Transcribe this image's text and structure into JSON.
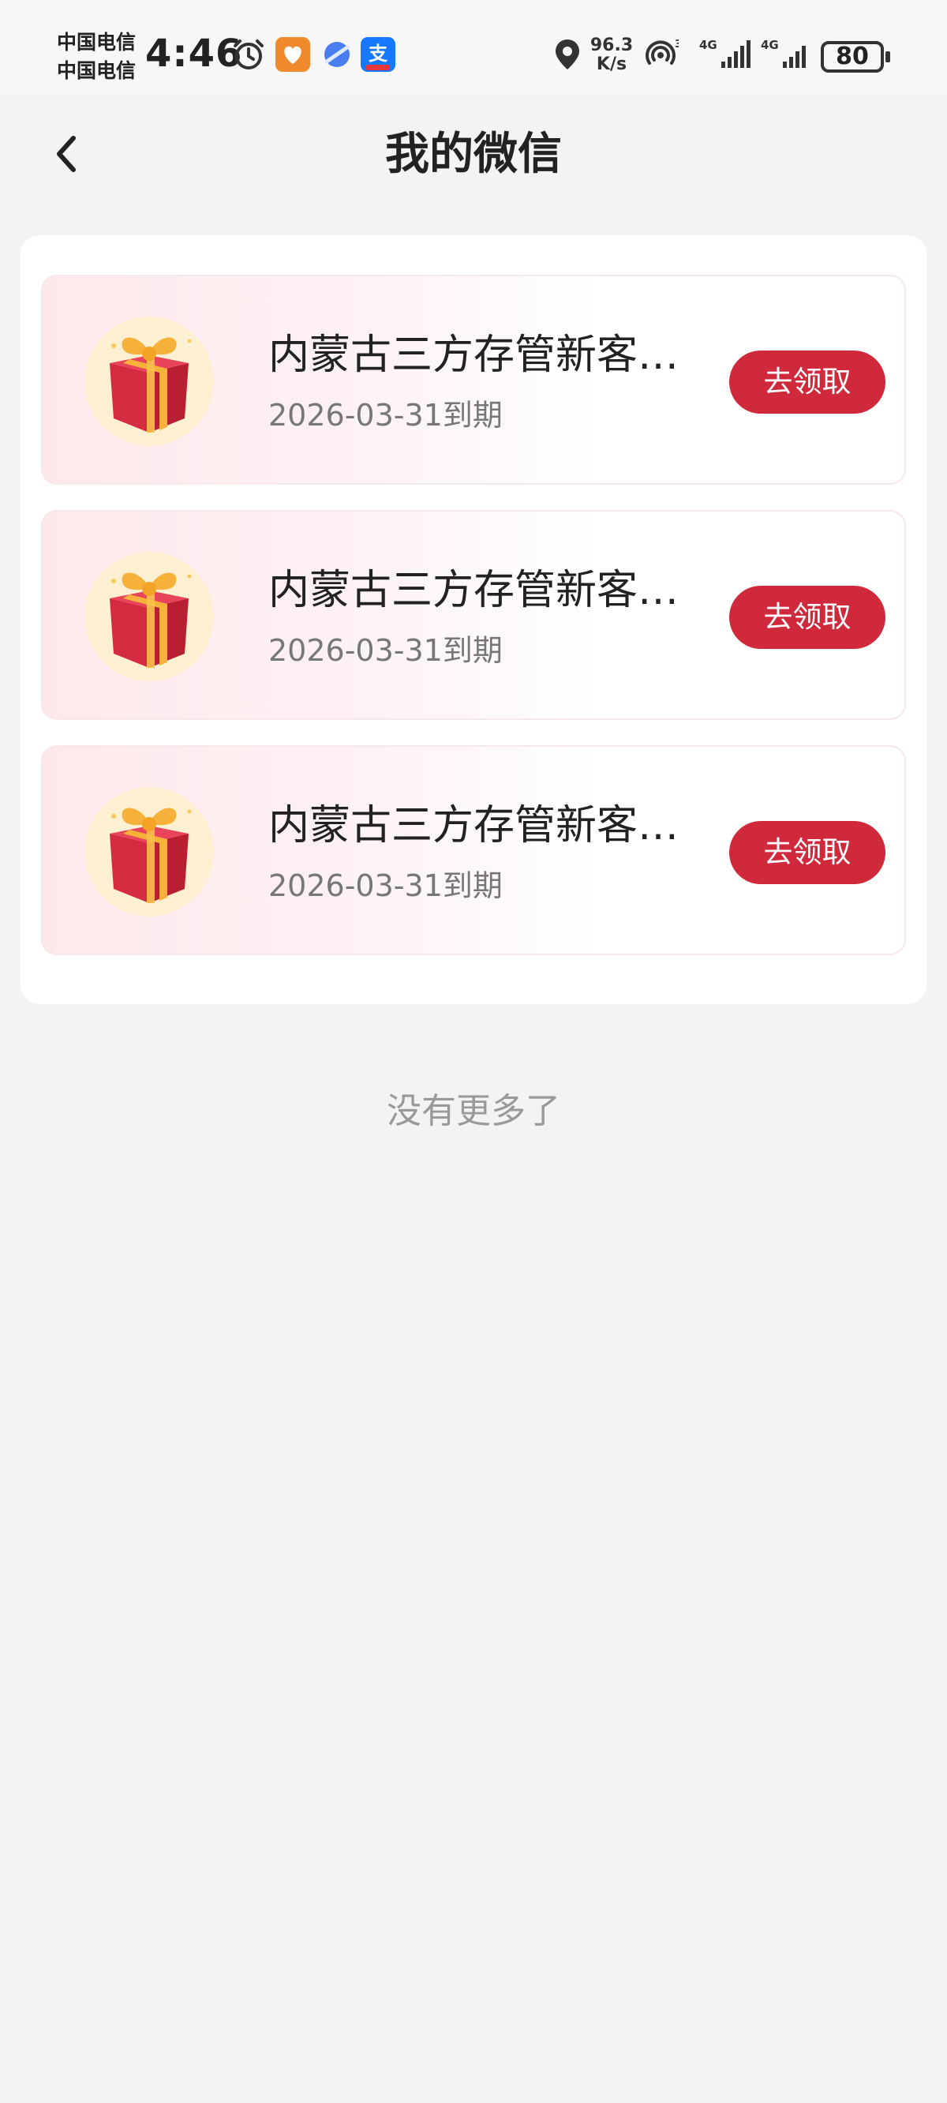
{
  "status_bar": {
    "carrier_1": "中国电信",
    "carrier_2": "中国电信",
    "time": "4:46",
    "net_speed_value": "96.3",
    "net_speed_unit": "K/s",
    "battery": "80",
    "icons": [
      "alarm-icon",
      "health-app-icon",
      "browser-app-icon",
      "alipay-app-icon",
      "location-icon",
      "hotspot-icon",
      "signal-4g-icon",
      "signal-4g-icon"
    ]
  },
  "nav": {
    "title": "我的微信",
    "back_icon": "chevron-left-icon"
  },
  "items": [
    {
      "title": "内蒙古三方存管新客…",
      "date": "2026-03-31到期",
      "button": "去领取",
      "icon": "gift-box-icon"
    },
    {
      "title": "内蒙古三方存管新客…",
      "date": "2026-03-31到期",
      "button": "去领取",
      "icon": "gift-box-icon"
    },
    {
      "title": "内蒙古三方存管新客…",
      "date": "2026-03-31到期",
      "button": "去领取",
      "icon": "gift-box-icon"
    }
  ],
  "footer": {
    "end_text": "没有更多了"
  },
  "colors": {
    "accent": "#d0293b",
    "background": "#f3f3f3",
    "card": "#ffffff"
  }
}
